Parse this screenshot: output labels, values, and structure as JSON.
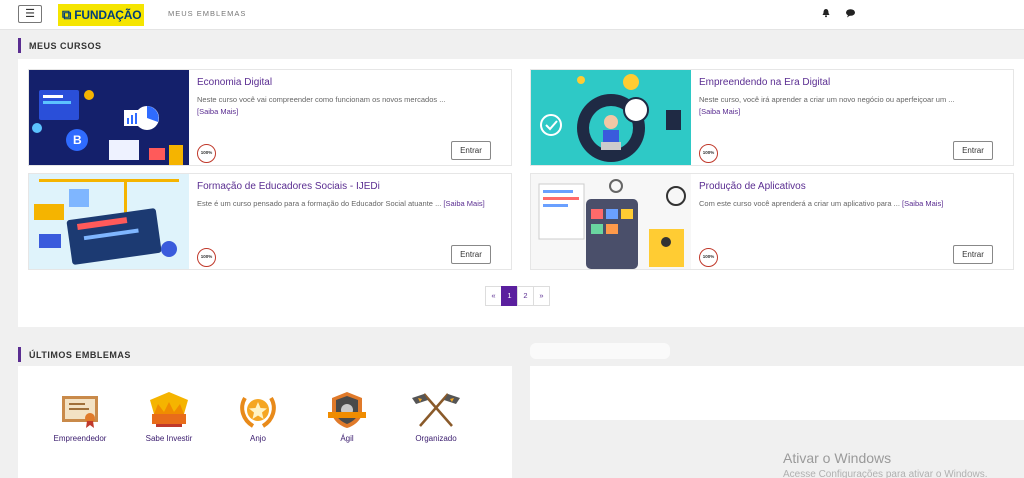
{
  "header": {
    "menu_glyph": "☰",
    "brand": "FUNDAÇÃO",
    "nav_link": "MEUS EMBLEMAS",
    "icons": [
      "bell-icon",
      "chat-icon"
    ]
  },
  "courses_section": {
    "title": "MEUS CURSOS",
    "courses": [
      {
        "title": "Economia Digital",
        "description": "Neste curso você vai compreender como funcionam os novos mercados ...",
        "more_label": "[Saiba Mais]",
        "progress_label": "100%",
        "progress": 1.0,
        "button_label": "Entrar"
      },
      {
        "title": "Empreendendo na Era Digital",
        "description": "Neste curso, você irá aprender a criar um novo negócio ou aperfeiçoar um ...",
        "more_label": "[Saiba Mais]",
        "progress_label": "100%",
        "progress": 1.0,
        "button_label": "Entrar"
      },
      {
        "title": "Formação de Educadores Sociais - IJEDi",
        "description": "Este é um curso pensado para a formação do Educador Social atuante ...",
        "more_label": "[Saiba Mais]",
        "progress_label": "100%",
        "progress": 1.0,
        "button_label": "Entrar"
      },
      {
        "title": "Produção de Aplicativos",
        "description": "Com este curso você aprenderá a criar um aplicativo para ...",
        "more_label": "[Saiba Mais]",
        "progress_label": "100%",
        "progress": 1.0,
        "button_label": "Entrar"
      }
    ],
    "pagination": {
      "prev": "«",
      "pages": [
        "1",
        "2"
      ],
      "current": "1",
      "next": "»"
    }
  },
  "emblems_section": {
    "title": "ÚLTIMOS EMBLEMAS",
    "emblems": [
      {
        "label": "Empreendedor",
        "icon": "certificate-icon"
      },
      {
        "label": "Sabe Investir",
        "icon": "crown-icon"
      },
      {
        "label": "Anjo",
        "icon": "star-wreath-icon"
      },
      {
        "label": "Ágil",
        "icon": "shield-badge-icon"
      },
      {
        "label": "Organizado",
        "icon": "crossed-flags-icon"
      }
    ]
  },
  "os_watermark": {
    "line1": "Ativar o Windows",
    "line2": "Acesse Configurações para ativar o Windows."
  },
  "colors": {
    "accent": "#5a2d91",
    "brand_yellow": "#f5e500",
    "brand_blue": "#003d7a",
    "progress_ring": "#c0392b"
  }
}
